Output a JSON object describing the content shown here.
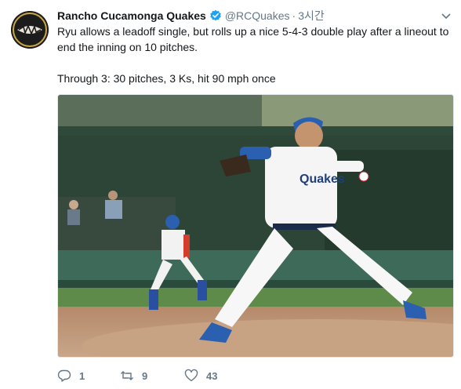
{
  "tweet": {
    "author_name": "Rancho Cucamonga Quakes",
    "handle": "@RCQuakes",
    "separator": "·",
    "time": "3시간",
    "paragraphs": [
      "Ryu allows a leadoff single, but rolls up a nice 5-4-3 double play after a lineout to end the inning on 10 pitches.",
      "Through 3: 30 pitches, 3 Ks, hit 90 mph once"
    ],
    "avatar_icon": "quakes-logo",
    "verified_icon": "verified-badge-icon",
    "accent_color": "#1da1f2"
  },
  "media": {
    "description_icon": "baseball-pitcher-photo",
    "jersey_text": "Quakes"
  },
  "actions": {
    "reply_count": "1",
    "retweet_count": "9",
    "like_count": "43"
  }
}
